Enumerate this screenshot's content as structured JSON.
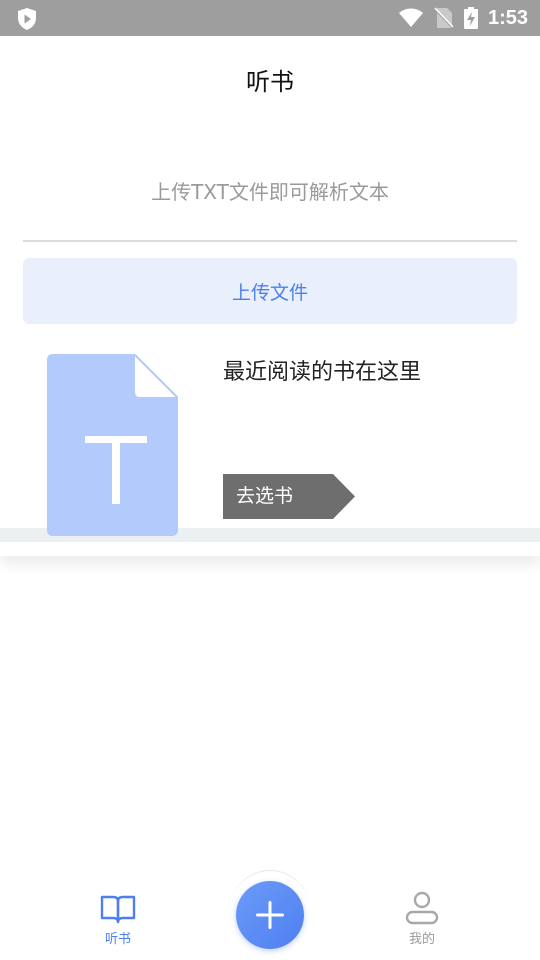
{
  "status_bar": {
    "time": "1:53",
    "icons": [
      "app-shield-icon",
      "wifi-icon",
      "no-sim-icon",
      "battery-charging-icon"
    ]
  },
  "header": {
    "title": "听书"
  },
  "upload": {
    "hint": "上传TXT文件即可解析文本",
    "button_label": "上传文件"
  },
  "recent": {
    "text": "最近阅读的书在这里",
    "cover_icon": "txt-file-icon",
    "choose_label": "去选书"
  },
  "bottom_nav": {
    "tabs": [
      {
        "label": "听书",
        "icon": "book-icon",
        "active": true
      },
      {
        "label": "我的",
        "icon": "user-icon",
        "active": false
      }
    ],
    "add_icon": "plus-icon"
  },
  "colors": {
    "accent": "#4d7ff0",
    "status_bar": "#9e9e9e",
    "upload_bg": "#e9f0fc",
    "cover": "#b3cafc",
    "choose_bg": "#6e6e6e"
  }
}
